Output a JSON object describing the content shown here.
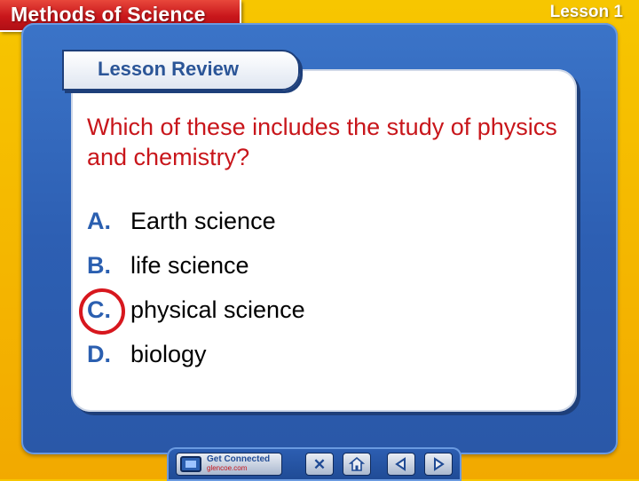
{
  "header": {
    "chapter_title": "Methods of Science",
    "lesson_label": "Lesson 1"
  },
  "review": {
    "banner_title": "Lesson Review",
    "question": "Which of these includes the study of physics and chemistry?",
    "options": [
      {
        "letter": "A.",
        "text": "Earth science"
      },
      {
        "letter": "B.",
        "text": "life science"
      },
      {
        "letter": "C.",
        "text": "physical science",
        "selected": true
      },
      {
        "letter": "D.",
        "text": "biology"
      }
    ]
  },
  "nav": {
    "connected_label": "Get Connected",
    "connected_url": "glencoe.com",
    "close_icon": "close-icon",
    "home_icon": "home-icon",
    "prev_icon": "previous-icon",
    "next_icon": "next-icon"
  },
  "colors": {
    "background": "#f2b400",
    "panel_blue": "#2d5fb3",
    "question_red": "#c8161b",
    "letter_blue": "#2b5fb0",
    "answer_ring": "#d7171e"
  }
}
